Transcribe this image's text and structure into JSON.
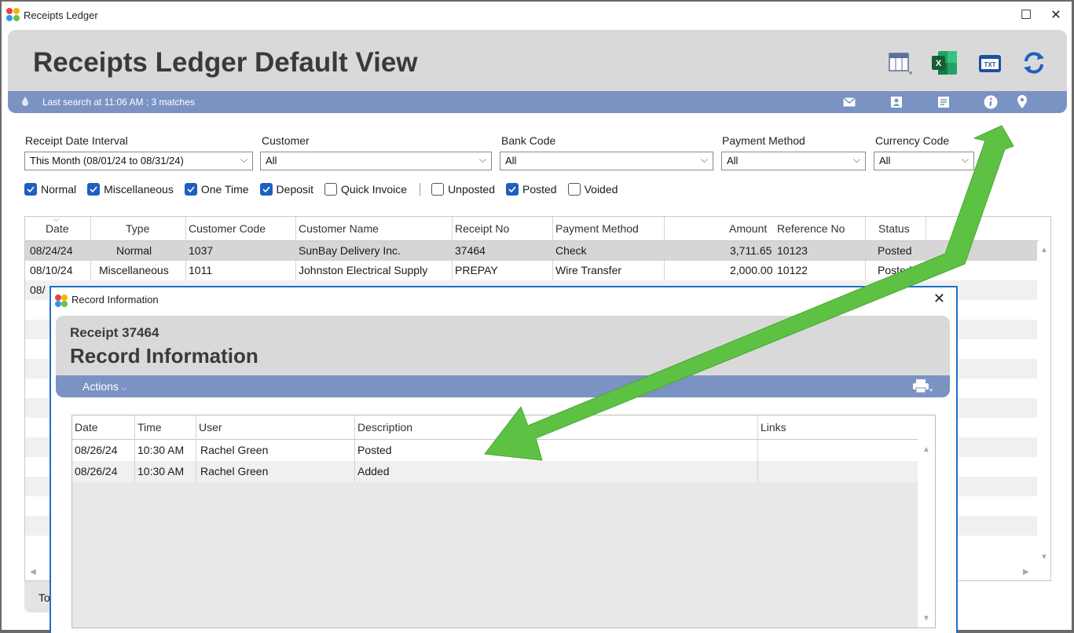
{
  "window": {
    "title": "Receipts Ledger",
    "maximize_glyph": "☐",
    "close_glyph": "✕"
  },
  "header": {
    "title": "Receipts Ledger Default View",
    "status": "Last search at 11:06 AM ; 3 matches",
    "txt_label": "TXT",
    "excel_label": "X"
  },
  "filters": {
    "date_interval": {
      "label": "Receipt Date Interval",
      "value": "This Month (08/01/24 to 08/31/24)"
    },
    "customer": {
      "label": "Customer",
      "value": "All"
    },
    "bank_code": {
      "label": "Bank Code",
      "value": "All"
    },
    "payment_method": {
      "label": "Payment Method",
      "value": "All"
    },
    "currency_code": {
      "label": "Currency Code",
      "value": "All"
    }
  },
  "checkboxes": [
    {
      "label": "Normal",
      "checked": true
    },
    {
      "label": "Miscellaneous",
      "checked": true
    },
    {
      "label": "One Time",
      "checked": true
    },
    {
      "label": "Deposit",
      "checked": true
    },
    {
      "label": "Quick Invoice",
      "checked": false
    },
    {
      "label": "Unposted",
      "checked": false
    },
    {
      "label": "Posted",
      "checked": true
    },
    {
      "label": "Voided",
      "checked": false
    }
  ],
  "table": {
    "columns": [
      "Date",
      "Type",
      "Customer Code",
      "Customer Name",
      "Receipt No",
      "Payment Method",
      "Amount",
      "Reference No",
      "Status"
    ],
    "rows": [
      [
        "08/24/24",
        "Normal",
        "1037",
        "SunBay Delivery Inc.",
        "37464",
        "Check",
        "3,711.65",
        "10123",
        "Posted"
      ],
      [
        "08/10/24",
        "Miscellaneous",
        "1011",
        "Johnston Electrical Supply",
        "PREPAY",
        "Wire Transfer",
        "2,000.00",
        "10122",
        "Posted"
      ],
      [
        "08/",
        "",
        "",
        "",
        "",
        "",
        "",
        "",
        ""
      ]
    ],
    "totals_tab": "To"
  },
  "dialog": {
    "window_title": "Record Information",
    "subtitle": "Receipt 37464",
    "title": "Record Information",
    "actions_label": "Actions",
    "close_glyph": "✕",
    "columns": [
      "Date",
      "Time",
      "User",
      "Description",
      "Links"
    ],
    "rows": [
      [
        "08/26/24",
        "10:30 AM",
        "Rachel Green",
        "Posted",
        ""
      ],
      [
        "08/26/24",
        "10:30 AM",
        "Rachel Green",
        "Added",
        ""
      ]
    ]
  },
  "colors": {
    "accent_bar": "#7b93c3",
    "header_bg": "#d9d9d9",
    "checkbox_on": "#1f5fbf",
    "dialog_border": "#1e6fcc",
    "annotation_arrow": "#5dc243"
  }
}
